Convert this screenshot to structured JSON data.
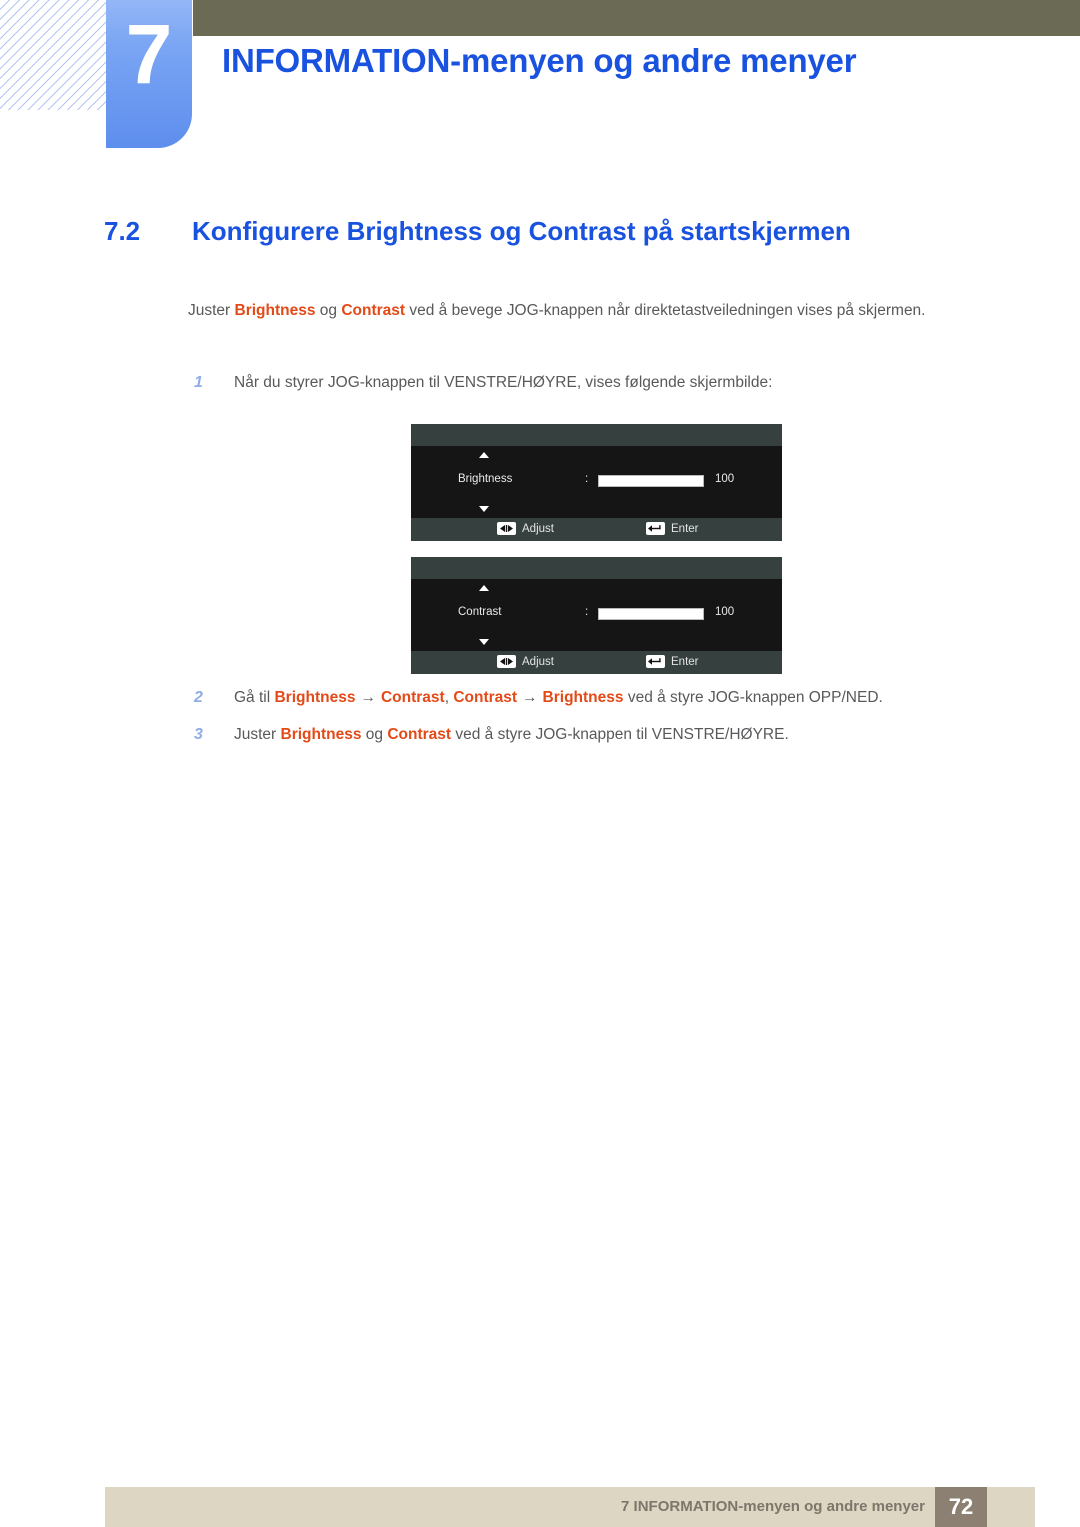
{
  "chapter": {
    "number": "7",
    "title": "INFORMATION-menyen og andre menyer"
  },
  "section": {
    "number": "7.2",
    "title": "Konfigurere Brightness og Contrast på startskjermen"
  },
  "intro": {
    "t1": "Juster ",
    "b1": "Brightness",
    "t2": " og ",
    "b2": "Contrast",
    "t3": " ved å bevege JOG-knappen når direktetastveiledningen vises på skjermen."
  },
  "steps": {
    "s1": {
      "num": "1",
      "text": "Når du styrer JOG-knappen til VENSTRE/HØYRE, vises følgende skjermbilde:"
    },
    "s2": {
      "num": "2",
      "t1": "Gå til ",
      "b1": "Brightness",
      "arrow1": "→",
      "b2": "Contrast",
      "t2": ", ",
      "b3": "Contrast",
      "arrow2": "→",
      "b4": "Brightness",
      "t3": " ved å styre JOG-knappen OPP/NED."
    },
    "s3": {
      "num": "3",
      "t1": "Juster ",
      "b1": "Brightness",
      "t2": " og ",
      "b2": "Contrast",
      "t3": " ved å styre JOG-knappen til VENSTRE/HØYRE."
    }
  },
  "osd": {
    "brightness": {
      "label": "Brightness",
      "colon": ":",
      "value": "100",
      "fill_percent": 100,
      "adjust_label": "Adjust",
      "enter_label": "Enter"
    },
    "contrast": {
      "label": "Contrast",
      "colon": ":",
      "value": "100",
      "fill_percent": 100,
      "adjust_label": "Adjust",
      "enter_label": "Enter"
    }
  },
  "footer": {
    "text": "7 INFORMATION-menyen og andre menyer",
    "page": "72"
  },
  "colors": {
    "heading_blue": "#1A52E0",
    "highlight_orange": "#E34A17",
    "olive_bar": "#6B6A54",
    "footer_bar": "#DCD6C2",
    "page_box": "#8C8073",
    "body_gray": "#58595B"
  }
}
